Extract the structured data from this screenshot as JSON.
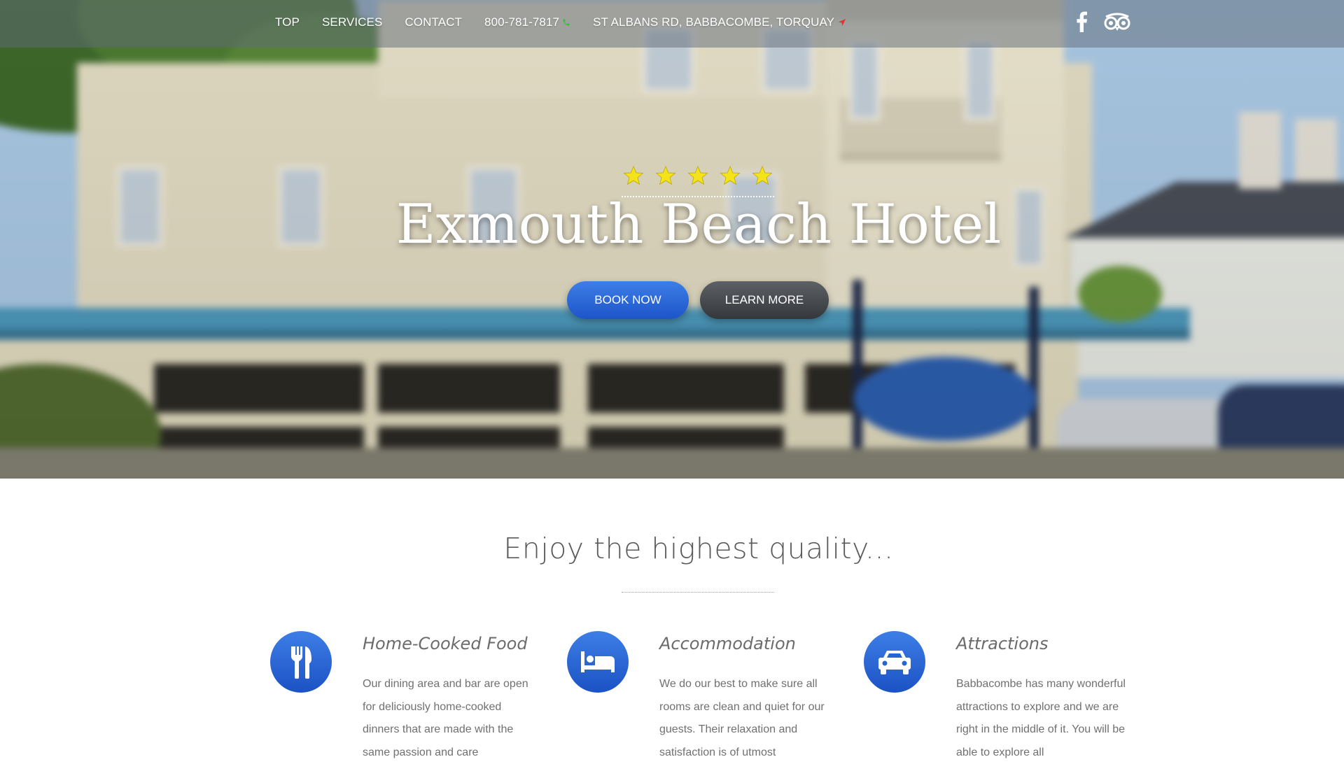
{
  "nav": {
    "items": [
      {
        "label": "TOP"
      },
      {
        "label": "SERVICES"
      },
      {
        "label": "CONTACT"
      }
    ],
    "phone": "800-781-7817",
    "address": "ST ALBANS RD, BABBACOMBE, TORQUAY",
    "icons": {
      "phone": "phone-icon",
      "address": "location-arrow-icon",
      "facebook": "facebook-icon",
      "tripadvisor": "tripadvisor-icon"
    }
  },
  "hero": {
    "rating": 5,
    "title": "Exmouth Beach Hotel",
    "book_label": "BOOK NOW",
    "learn_label": "LEARN MORE"
  },
  "features": {
    "heading": "Enjoy the highest quality...",
    "items": [
      {
        "icon": "cutlery-icon",
        "title": "Home-Cooked Food",
        "text": "Our dining area and bar are open for deliciously home-cooked dinners that are made with the same passion and care"
      },
      {
        "icon": "bed-icon",
        "title": "Accommodation",
        "text": "We do our best to make sure all rooms are clean and quiet for our guests. Their relaxation and satisfaction is of utmost"
      },
      {
        "icon": "car-icon",
        "title": "Attractions",
        "text": "Babbacombe has many wonderful attractions to explore and we are right in the middle of it. You will be able to explore all"
      }
    ]
  },
  "colors": {
    "accent_blue": "#2762d6",
    "star_yellow": "#f5e31a",
    "phone_green": "#2fbf3a",
    "pin_red": "#e0342c",
    "nav_bar": "#5f6978"
  }
}
